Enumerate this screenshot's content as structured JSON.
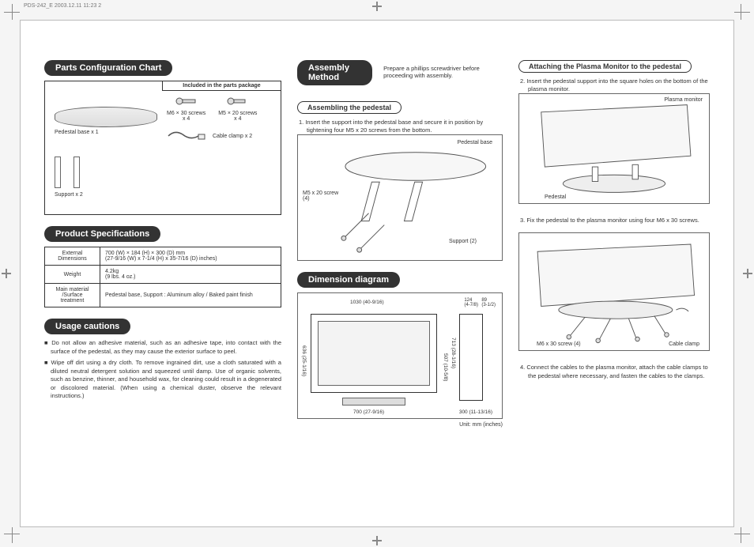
{
  "meta": {
    "header": "PDS-242_E   2003.12.11  11:23   2"
  },
  "sections": {
    "parts": {
      "title": "Parts Configuration Chart",
      "included_header": "Included in the parts package",
      "labels": {
        "pedestal_base": "Pedestal base x 1",
        "support": "Support x 2",
        "m6_screws": "M6 × 30 screws\nx 4",
        "m5_screws": "M5 × 20 screws\nx 4",
        "cable_clamp": "Cable clamp x 2"
      }
    },
    "specs": {
      "title": "Product Specifications",
      "rows": [
        {
          "label": "External\nDimensions",
          "value": "700 (W) × 184 (H) × 300 (D) mm\n(27-9/16 (W) x 7-1/4 (H) x 35-7/16 (D) inches)"
        },
        {
          "label": "Weight",
          "value": "4.2kg\n(9 lbs. 4 oz.)"
        },
        {
          "label": "Main material\n/Surface\ntreatment",
          "value": "Pedestal base, Support : Aluminum alloy / Baked paint finish"
        }
      ]
    },
    "cautions": {
      "title": "Usage cautions",
      "items": [
        "Do not allow an adhesive material, such as an adhesive tape, into contact with the surface of the pedestal, as they may cause the exterior surface to peel.",
        "Wipe off dirt using a dry cloth. To remove ingrained dirt, use a cloth saturated with a diluted neutral detergent solution and squeezed until damp. Use of organic solvents, such as benzine, thinner, and household wax, for cleaning could result in a degenerated or discolored material. (When using a chemical duster, observe the relevant instructions.)"
      ]
    },
    "assembly": {
      "title": "Assembly Method",
      "intro": "Prepare a phillips screwdriver before proceeding with assembly.",
      "sub1": {
        "title": "Assembling the pedestal",
        "step": "1. Insert the support into the pedestal base and secure it in position by tightening four M5 x 20 screws from the bottom.",
        "callouts": {
          "base": "Pedestal base",
          "screw": "M5 x 20 screw\n(4)",
          "support": "Support (2)"
        }
      },
      "sub2": {
        "title": "Attaching the Plasma Monitor to the pedestal",
        "step": "2. Insert the pedestal support into the square holes on the bottom of the plasma monitor.",
        "callouts": {
          "monitor": "Plasma monitor",
          "pedestal": "Pedestal"
        }
      },
      "step3": {
        "text": "3. Fix the pedestal to the plasma monitor using four M6 x 30 screws.",
        "callouts": {
          "screw": "M6 x 30 screw (4)",
          "clamp": "Cable clamp"
        }
      },
      "step4": "4. Connect the cables to the plasma monitor, attach the cable clamps to the pedestal where necessary, and fasten the cables to the clamps."
    },
    "dimension": {
      "title": "Dimension diagram",
      "labels": {
        "top_w": "1030 (40-9/16)",
        "h_left": "636 (25-1/16)",
        "base_w": "700 (27-9/16)",
        "side_h1": "713 (28-1/16)",
        "side_h2": "507 (10-5/8)",
        "side_d": "300 (11-13/16)",
        "d1": "124\n(4-7/8)",
        "d2": "89\n(3-1/2)"
      },
      "unit_note": "Unit: mm (inches)"
    }
  }
}
